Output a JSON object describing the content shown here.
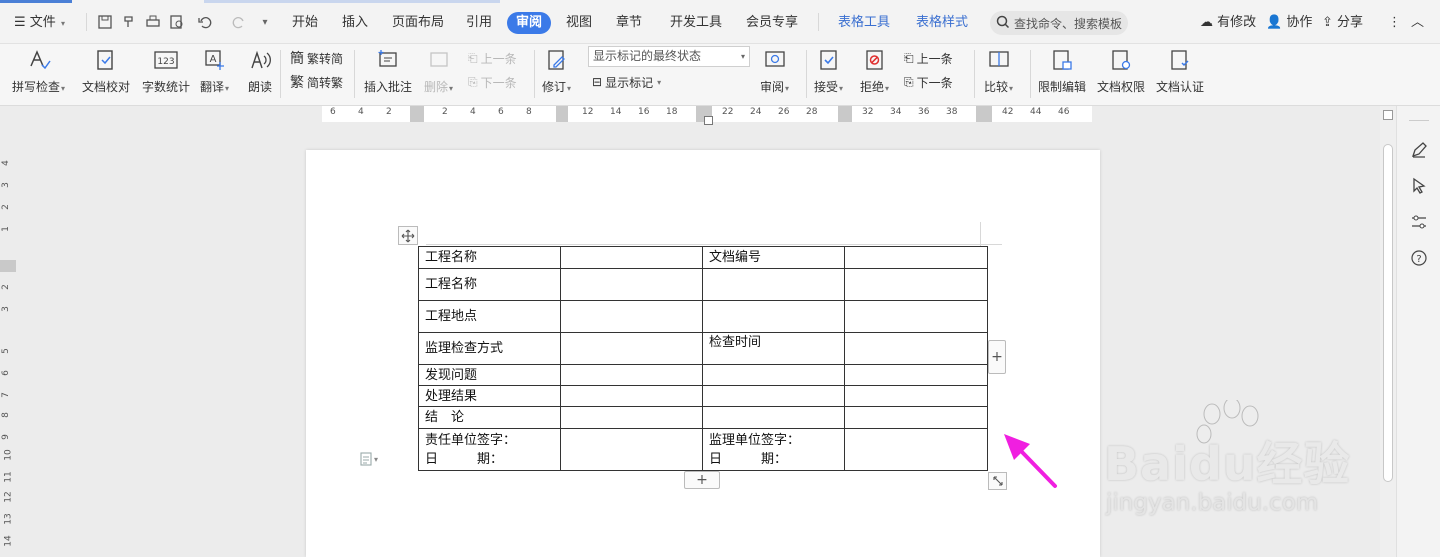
{
  "menubar": {
    "file_label": "文件",
    "tabs": [
      "开始",
      "插入",
      "页面布局",
      "引用",
      "审阅",
      "视图",
      "章节",
      "开发工具",
      "会员专享"
    ],
    "active_tab": "审阅",
    "context_tabs": [
      "表格工具",
      "表格样式"
    ],
    "search_placeholder": "查找命令、搜索模板",
    "status_label": "有修改",
    "collab_label": "协作",
    "share_label": "分享"
  },
  "ribbon": {
    "spell_check": "拼写检查",
    "doc_proof": "文档校对",
    "word_count": "字数统计",
    "translate": "翻译",
    "read_aloud": "朗读",
    "trad_to_simp": "繁转简",
    "simp_to_trad": "简转繁",
    "insert_comment": "插入批注",
    "delete": "删除",
    "prev_item": "上一条",
    "next_item": "下一条",
    "track_changes": "修订",
    "markup_state": "显示标记的最终状态",
    "show_markup": "显示标记",
    "review": "审阅",
    "accept": "接受",
    "reject": "拒绝",
    "prev_change": "上一条",
    "next_change": "下一条",
    "compare": "比较",
    "restrict_edit": "限制编辑",
    "doc_permission": "文档权限",
    "doc_certify": "文档认证",
    "icon_123": "123",
    "icon_han": "簡",
    "icon_fan": "繁"
  },
  "ruler": {
    "h_ticks": [
      "6",
      "4",
      "2",
      "2",
      "4",
      "6",
      "8",
      "12",
      "14",
      "16",
      "18",
      "22",
      "24",
      "26",
      "28",
      "32",
      "34",
      "36",
      "38",
      "42",
      "44",
      "46"
    ],
    "v_ticks": [
      "4",
      "3",
      "2",
      "1",
      "2",
      "3",
      "5",
      "6",
      "7",
      "8",
      "9",
      "10",
      "11",
      "12",
      "13",
      "14"
    ]
  },
  "table": {
    "rows": [
      [
        "工程名称",
        "",
        "文档编号",
        ""
      ],
      [
        "工程名称",
        "",
        "",
        ""
      ],
      [
        "工程地点",
        "",
        "",
        ""
      ],
      [
        "监理检查方式",
        "",
        "检查时间",
        ""
      ],
      [
        "发现问题",
        "",
        "",
        ""
      ],
      [
        "处理结果",
        "",
        "",
        ""
      ],
      [
        "结　论",
        "",
        "",
        ""
      ],
      [
        "责任单位签字：\n日　　　期：",
        "",
        "监理单位签字：\n日　　　期：",
        ""
      ]
    ]
  },
  "watermark": {
    "brand": "Baidu经验",
    "url": "jingyan.baidu.com"
  },
  "colors": {
    "accent": "#3b7ae8",
    "arrow": "#f01fe0"
  }
}
